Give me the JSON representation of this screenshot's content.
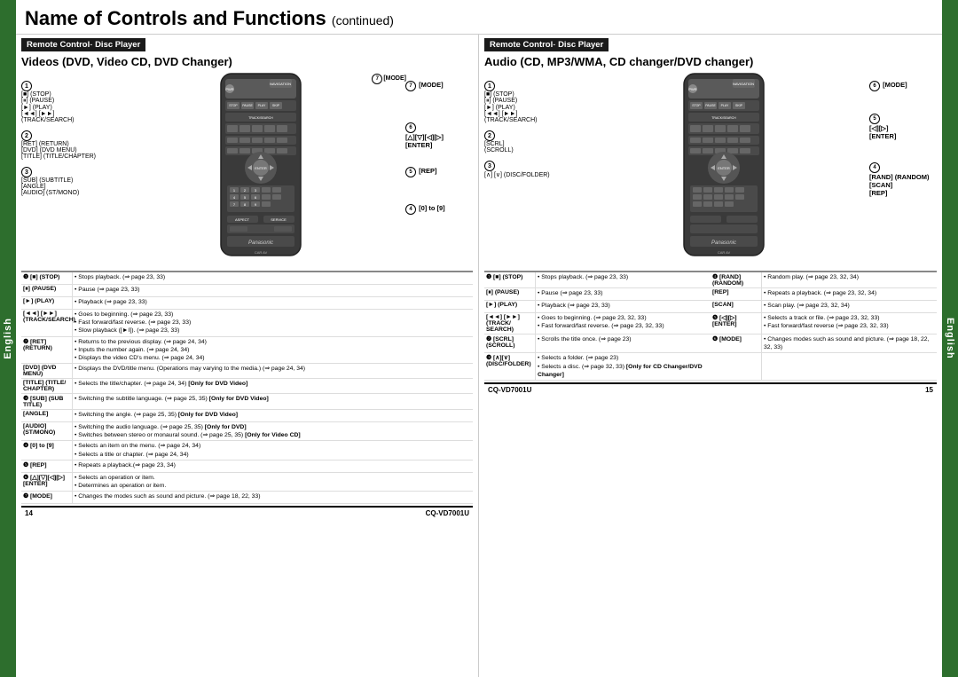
{
  "page": {
    "title": "Name of Controls and Functions",
    "title_suffix": "continued",
    "left_tab": "English",
    "right_tab": "English",
    "page_left": "14",
    "page_right": "15",
    "model": "CQ-VD7001U"
  },
  "left_section": {
    "badge": "Remote Control- Disc Player",
    "subtitle": "Videos (DVD, Video CD, DVD Changer)",
    "labels_left": [
      {
        "num": "1",
        "items": [
          "[■] (STOP)",
          "[⏸] (PAUSE)",
          "[►] (PLAY)",
          "[◄◄] [►►] (TRACK/SEARCH)"
        ]
      },
      {
        "num": "2",
        "items": [
          "[RET] (RETURN)",
          "[DVD] (DVD MENU)",
          "[TITLE] (TITLE/CHAPTER)"
        ]
      },
      {
        "num": "3",
        "items": [
          "[SUB] (SUBTITLE)",
          "[ANGLE]",
          "[AUDIO] (ST/MONO)"
        ]
      }
    ],
    "labels_right": [
      {
        "num": "7",
        "items": [
          "[MODE]"
        ]
      },
      {
        "num": "6",
        "items": [
          "[△][▽][◁][▷]",
          "[ENTER]"
        ]
      },
      {
        "num": "5",
        "items": [
          "[REP]"
        ]
      },
      {
        "num": "4",
        "items": [
          "[0] to [9]"
        ]
      }
    ],
    "desc_rows": [
      {
        "key": "❶ [■] (STOP)",
        "val": "• Stops playback. (⇒ page 23, 33)"
      },
      {
        "key": "[⏸] (PAUSE)",
        "val": "• Pause (⇒ page 23, 33)"
      },
      {
        "key": "[►] (PLAY)",
        "val": "• Playback (⇒ page 23, 33)"
      },
      {
        "key": "[◄◄] [►►] (TRACK/SEARCH)",
        "val": "• Goes to beginning. (⇒ page 23, 33)\n• Fast forward/fast reverse. (⇒ page 23, 33)\n• Slow playback ([►I]).(⇒ page 23, 33)"
      },
      {
        "key": "❷ [RET] (RETURN)",
        "val": "• Returns to the previous display. (⇒ page 24, 34)\n• Inputs the number again. (⇒ page 24, 34)\n• Displays the video CD's menu. (⇒ page 24, 34)"
      },
      {
        "key": "[DVD] (DVD MENU)",
        "val": "• Displays the DVD/title menu. (Operations may varying to the media.) (⇒ page 24, 34)"
      },
      {
        "key": "[TITLE] (TITLE/CHAPTER)",
        "val": "• Selects the title/chapter. (⇒ page 24, 34) [Only for DVD Video]"
      },
      {
        "key": "❸ [SUB] (SUB TITLE)",
        "val": "• Switching the subtitle language. (⇒ page 25, 35) [Only for DVD Video]"
      },
      {
        "key": "[ANGLE]",
        "val": "• Switching the angle. (⇒ page 25, 35) [Only for DVD Video]"
      },
      {
        "key": "[AUDIO] (ST/MONO)",
        "val": "• Switching the audio language. (⇒ page 25, 35) [Only for DVD]\n• Switches between stereo or monaural sound. (⇒ page 25, 35) [Only for Video CD]"
      },
      {
        "key": "❹ [0] to [9]",
        "val": "• Selects an item on the menu. (⇒ page 24, 34)\n• Selects a title or chapter. (⇒ page 24, 34)"
      },
      {
        "key": "❺ [REP]",
        "val": "• Repeats a playback.(⇒ page 23, 34)"
      },
      {
        "key": "❻ [△][▽][◁][▷] [ENTER]",
        "val": "• Selects an operation or item.\n• Determines an operation or item."
      },
      {
        "key": "❼ [MODE]",
        "val": "• Changes the modes such as sound and picture. (⇒ page 18, 22, 33)"
      }
    ]
  },
  "right_section": {
    "badge": "Remote Control- Disc Player",
    "subtitle": "Audio (CD, MP3/WMA, CD changer/DVD changer)",
    "labels_left": [
      {
        "num": "1",
        "items": [
          "[■] (STOP)",
          "[⏸] (PAUSE)",
          "[►] (PLAY)",
          "[◄◄] [►►] (TRACK/SEARCH)"
        ]
      },
      {
        "num": "2",
        "items": [
          "[SCRL] (SCROLL)"
        ]
      },
      {
        "num": "3",
        "items": [
          "[∧][∨] (DISC/FOLDER)"
        ]
      }
    ],
    "labels_right": [
      {
        "num": "6",
        "items": [
          "[MODE]"
        ]
      },
      {
        "num": "5",
        "items": [
          "[◁][▷]",
          "[ENTER]"
        ]
      },
      {
        "num": "4",
        "items": [
          "[RAND] (RANDOM)",
          "[SCAN]",
          "[REP]"
        ]
      }
    ],
    "desc_rows": [
      {
        "key": "❶ [■] (STOP)",
        "val": "• Stops playback. (⇒ page 23, 33)"
      },
      {
        "key": "[⏸] (PAUSE)",
        "val": "• Pause (⇒ page 23, 33)"
      },
      {
        "key": "[►] (PLAY)",
        "val": "• Playback (⇒ page 23, 33)"
      },
      {
        "key": "[◄◄] [►►] (TRACK/ SEARCH)",
        "val": "• Goes to beginning. (⇒ page 23, 32, 33)\n• Fast forward/fast reverse. (⇒ page 23, 32, 33)"
      },
      {
        "key": "❷ [SCRL] (SCROLL)",
        "val": "• Scrolls the title once. (⇒ page 23)"
      },
      {
        "key": "❸ [∧][∨] (DISC/FOLDER)",
        "val": "• Selects a folder. (⇒ page 23)\n• Selects a disc. (⇒ page 32, 33) [Only for CD Changer/DVD Changer]"
      },
      {
        "key": "❹ [RAND] (RANDOM)",
        "val": "• Random play. (⇒ page 23, 32, 34)"
      },
      {
        "key": "[REP]",
        "val": "• Repeats a playback. (⇒ page 23, 32, 34)"
      },
      {
        "key": "[SCAN]",
        "val": "• Scan play. (⇒ page 23, 32, 34)"
      },
      {
        "key": "❺ [◁][▷] [ENTER]",
        "val": "• Selects a track or file. (⇒ page 23, 32, 33)\n• Fast forward/fast reverse (⇒ page 23, 32, 33)"
      },
      {
        "key": "❻ [MODE]",
        "val": "• Changes modes such as sound and picture. (⇒ page 18, 22, 32, 33)"
      }
    ]
  }
}
